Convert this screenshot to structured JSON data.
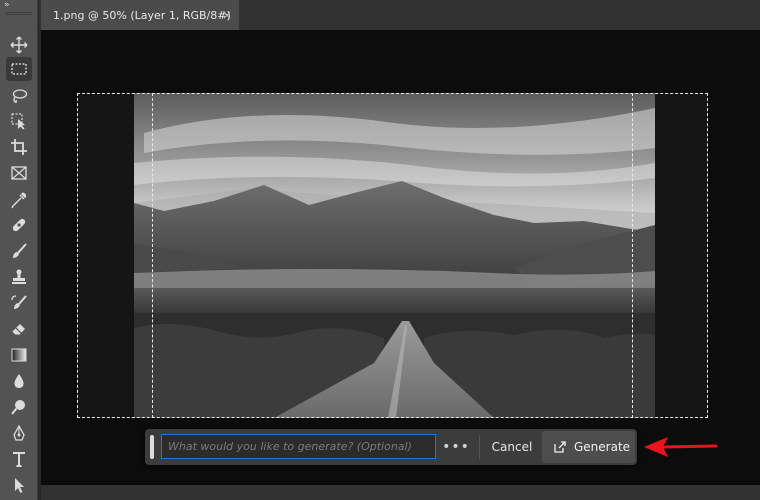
{
  "document": {
    "tab_title": "1.png @ 50% (Layer 1, RGB/8#)",
    "close_glyph": "×"
  },
  "toolbar": {
    "collapse_glyph": "»",
    "tools": [
      {
        "name": "move-tool",
        "icon": "move-icon"
      },
      {
        "name": "rectangular-marquee-tool",
        "icon": "marquee-icon",
        "active": true
      },
      {
        "name": "lasso-tool",
        "icon": "lasso-icon"
      },
      {
        "name": "object-selection-tool",
        "icon": "object-select-icon"
      },
      {
        "name": "crop-tool",
        "icon": "crop-icon"
      },
      {
        "name": "frame-tool",
        "icon": "frame-icon"
      },
      {
        "name": "eyedropper-tool",
        "icon": "eyedropper-icon"
      },
      {
        "name": "healing-brush-tool",
        "icon": "bandage-icon"
      },
      {
        "name": "brush-tool",
        "icon": "brush-icon"
      },
      {
        "name": "clone-stamp-tool",
        "icon": "stamp-icon"
      },
      {
        "name": "history-brush-tool",
        "icon": "history-brush-icon"
      },
      {
        "name": "eraser-tool",
        "icon": "eraser-icon"
      },
      {
        "name": "gradient-tool",
        "icon": "gradient-icon"
      },
      {
        "name": "blur-tool",
        "icon": "drop-icon"
      },
      {
        "name": "dodge-tool",
        "icon": "dodge-icon"
      },
      {
        "name": "pen-tool",
        "icon": "pen-icon"
      },
      {
        "name": "type-tool",
        "icon": "type-icon"
      },
      {
        "name": "path-selection-tool",
        "icon": "arrow-icon"
      }
    ]
  },
  "taskbar": {
    "prompt_placeholder": "What would you like to generate? (Optional)",
    "prompt_value": "",
    "more_glyph": "•••",
    "cancel_label": "Cancel",
    "generate_label": "Generate"
  },
  "colors": {
    "accent_input_border": "#2d6fd6",
    "annotation_arrow": "#e8141c"
  }
}
